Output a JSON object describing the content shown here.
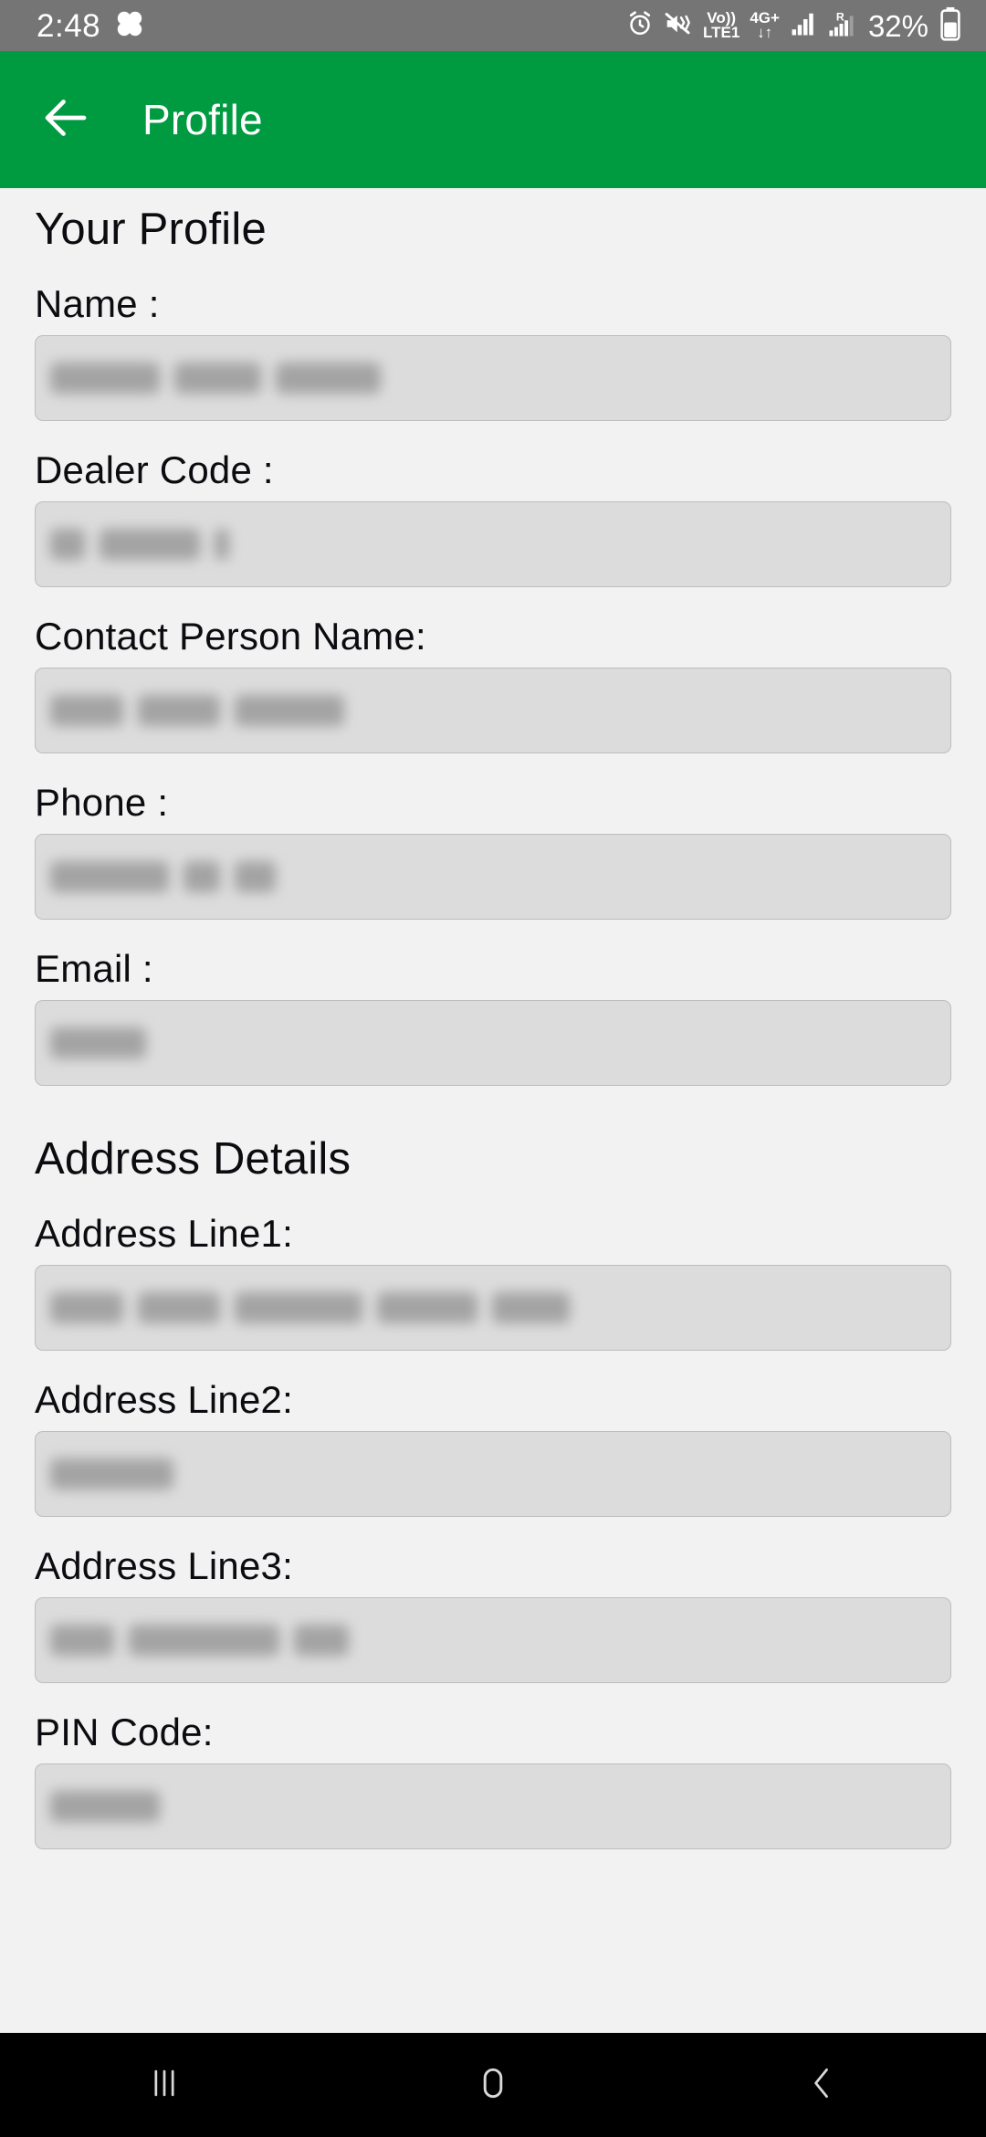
{
  "status_bar": {
    "time": "2:48",
    "left_icons": [
      "clover-app-icon"
    ],
    "right_icons": [
      "alarm-icon",
      "mute-vibrate-icon",
      "volte-icon",
      "network-4g-plus-icon",
      "signal-bars-icon",
      "roaming-signal-icon"
    ],
    "volte_top": "Vo))",
    "volte_bottom": "LTE1",
    "network_top": "4G+",
    "network_bottom": "↓↑",
    "roaming_label": "R",
    "battery_percent": "32%",
    "background_color": "#757575",
    "text_color": "#FFFFFF"
  },
  "app_bar": {
    "title": "Profile",
    "back_icon": "arrow-left-icon",
    "background_color": "#009B41",
    "text_color": "#FFFFFF"
  },
  "page": {
    "background_color": "#F2F2F2",
    "text_color": "#0B0B10"
  },
  "profile_section": {
    "heading": "Your Profile",
    "fields": [
      {
        "label": "Name :",
        "name": "name",
        "value": "",
        "redacted": true,
        "redaction_widths": [
          120,
          95,
          115
        ]
      },
      {
        "label": "Dealer Code :",
        "name": "dealer-code",
        "value": "",
        "redacted": true,
        "redaction_widths": [
          38,
          110,
          16
        ]
      },
      {
        "label": "Contact Person Name:",
        "name": "contact-person-name",
        "value": "",
        "redacted": true,
        "redaction_widths": [
          80,
          90,
          120
        ]
      },
      {
        "label": "Phone :",
        "name": "phone",
        "value": "",
        "redacted": true,
        "redaction_widths": [
          130,
          40,
          45
        ]
      },
      {
        "label": "Email :",
        "name": "email",
        "value": "",
        "redacted": true,
        "redaction_widths": [
          105
        ]
      }
    ]
  },
  "address_section": {
    "heading": "Address Details",
    "fields": [
      {
        "label": "Address Line1:",
        "name": "address-line-1",
        "value": "",
        "redacted": true,
        "redaction_widths": [
          80,
          90,
          140,
          110,
          85
        ]
      },
      {
        "label": "Address Line2:",
        "name": "address-line-2",
        "value": "",
        "redacted": true,
        "redaction_widths": [
          135
        ]
      },
      {
        "label": "Address Line3:",
        "name": "address-line-3",
        "value": "",
        "redacted": true,
        "redaction_widths": [
          70,
          165,
          60
        ]
      },
      {
        "label": "PIN Code:",
        "name": "pin-code",
        "value": "",
        "redacted": true,
        "redaction_widths": [
          120
        ]
      }
    ]
  },
  "nav_bar": {
    "background_color": "#000000",
    "buttons": [
      {
        "name": "recents-button",
        "icon": "recents-icon"
      },
      {
        "name": "home-button",
        "icon": "home-icon"
      },
      {
        "name": "back-button",
        "icon": "chevron-left-icon"
      }
    ]
  }
}
